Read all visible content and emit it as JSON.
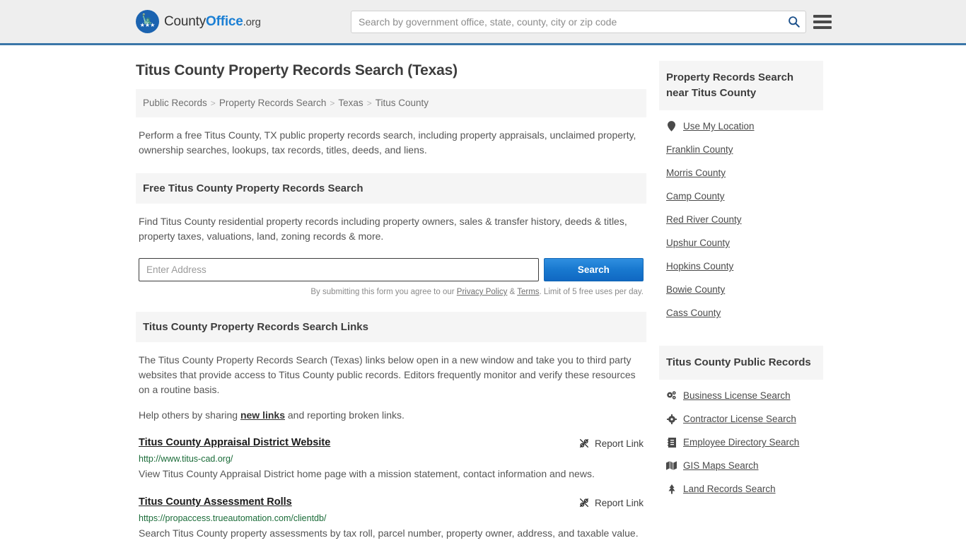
{
  "header": {
    "brand": {
      "part1": "County",
      "part2": "Office",
      "part3": ".org",
      "badge_icon": "eagle-seal-icon"
    },
    "search": {
      "placeholder": "Search by government office, state, county, city or zip code",
      "value": "",
      "icon": "search-icon"
    },
    "menu_icon": "hamburger-menu-icon",
    "border_color": "#3a76a8",
    "background": "#eeeeee"
  },
  "main": {
    "page_title": "Titus County Property Records Search (Texas)",
    "breadcrumb": [
      {
        "label": "Public Records"
      },
      {
        "label": "Property Records Search"
      },
      {
        "label": "Texas"
      },
      {
        "label": "Titus County"
      }
    ],
    "breadcrumb_separator": ">",
    "intro": "Perform a free Titus County, TX public property records search, including property appraisals, unclaimed property, ownership searches, lookups, tax records, titles, deeds, and liens.",
    "free_search": {
      "heading": "Free Titus County Property Records Search",
      "description": "Find Titus County residential property records including property owners, sales & transfer history, deeds & titles, property taxes, valuations, land, zoning records & more.",
      "address_placeholder": "Enter Address",
      "address_value": "",
      "search_button": "Search",
      "note_prefix": "By submitting this form you agree to our ",
      "note_privacy": "Privacy Policy",
      "note_amp": " & ",
      "note_terms": "Terms",
      "note_suffix": ". Limit of 5 free uses per day."
    },
    "links_section": {
      "heading": "Titus County Property Records Search Links",
      "description": "The Titus County Property Records Search (Texas) links below open in a new window and take you to third party websites that provide access to Titus County public records. Editors frequently monitor and verify these resources on a routine basis.",
      "help_prefix": "Help others by sharing ",
      "help_link": "new links",
      "help_suffix": " and reporting broken links.",
      "report_label": "Report Link",
      "report_icon": "broken-link-icon",
      "items": [
        {
          "title": "Titus County Appraisal District Website",
          "url": "http://www.titus-cad.org/",
          "description": "View Titus County Appraisal District home page with a mission statement, contact information and news."
        },
        {
          "title": "Titus County Assessment Rolls",
          "url": "https://propaccess.trueautomation.com/clientdb/",
          "description": "Search Titus County property assessments by tax roll, parcel number, property owner, address, and taxable value."
        }
      ]
    }
  },
  "sidebar": {
    "nearby": {
      "heading": "Property Records Search near Titus County",
      "items": [
        {
          "label": "Use My Location",
          "icon": "map-pin-icon"
        },
        {
          "label": "Franklin County",
          "icon": ""
        },
        {
          "label": "Morris County",
          "icon": ""
        },
        {
          "label": "Camp County",
          "icon": ""
        },
        {
          "label": "Red River County",
          "icon": ""
        },
        {
          "label": "Upshur County",
          "icon": ""
        },
        {
          "label": "Hopkins County",
          "icon": ""
        },
        {
          "label": "Bowie County",
          "icon": ""
        },
        {
          "label": "Cass County",
          "icon": ""
        }
      ]
    },
    "public_records": {
      "heading": "Titus County Public Records",
      "items": [
        {
          "label": "Business License Search",
          "icon": "cogs-icon"
        },
        {
          "label": "Contractor License Search",
          "icon": "gear-icon"
        },
        {
          "label": "Employee Directory Search",
          "icon": "address-book-icon"
        },
        {
          "label": "GIS Maps Search",
          "icon": "map-icon"
        },
        {
          "label": "Land Records Search",
          "icon": "tree-icon"
        }
      ]
    }
  }
}
